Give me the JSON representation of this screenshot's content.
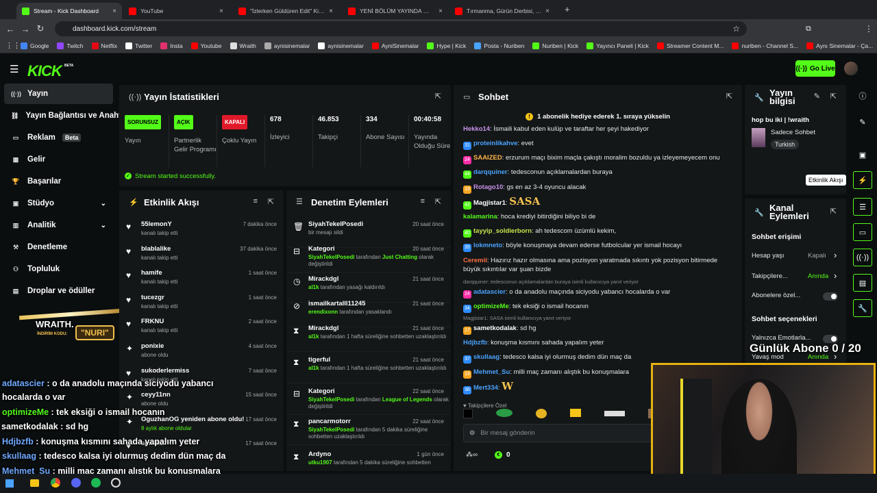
{
  "browser": {
    "tabs": [
      {
        "label": "Stream - Kick Dashboard",
        "active": true,
        "color": "#53fc18"
      },
      {
        "label": "YouTube",
        "active": false,
        "color": "#ff0000"
      },
      {
        "label": "\"İzlerken Güldüren Edit\" Kick &",
        "active": false,
        "color": "#ff0000"
      },
      {
        "label": "YENİ BÖLÜM YAYINDA 🏆 @O",
        "active": false,
        "color": "#ff0000"
      },
      {
        "label": "Tırmanma, Gürün Derbisi, Yüksel",
        "active": false,
        "color": "#ff0000"
      }
    ],
    "url": "dashboard.kick.com/stream",
    "bookmarks": [
      "Google",
      "Twitch",
      "Netflix",
      "Twitter",
      "Insta",
      "Youtube",
      "Wraith",
      "aynisinemalar",
      "aynisinemalar",
      "AyniSinemalar",
      "Hype | Kick",
      "Posta - Nuriben",
      "Nuriben | Kick",
      "Yayıncı Paneli | Kick",
      "Streamer Content M...",
      "nuriben - Channel S...",
      "Aynı Sinemalar - Ça..."
    ]
  },
  "header": {
    "logo": "KICK",
    "beta": "BETA",
    "go_live": "Go Live"
  },
  "sidebar": {
    "items": [
      {
        "label": "Yayın",
        "icon": "broadcast-icon",
        "glyph": "((·))"
      },
      {
        "label": "Yayın Bağlantısı ve Anahtarı",
        "icon": "link-icon",
        "glyph": "⛓"
      },
      {
        "label": "Reklam",
        "icon": "ad-icon",
        "glyph": "▭"
      },
      {
        "label": "Gelir",
        "icon": "revenue-icon",
        "glyph": "▦"
      },
      {
        "label": "Başarılar",
        "icon": "trophy-icon",
        "glyph": "🏆"
      },
      {
        "label": "Stüdyo",
        "icon": "studio-icon",
        "glyph": "▣"
      },
      {
        "label": "Analitik",
        "icon": "analytics-icon",
        "glyph": "▥"
      },
      {
        "label": "Denetleme",
        "icon": "moderation-icon",
        "glyph": "⚒"
      },
      {
        "label": "Topluluk",
        "icon": "community-icon",
        "glyph": "⚇"
      },
      {
        "label": "Droplar ve ödüller",
        "icon": "drops-icon",
        "glyph": "▤"
      }
    ],
    "beta_badge": "Beta"
  },
  "stats": {
    "title": "Yayın İstatistikleri",
    "cards": [
      {
        "badge": "SORUNSUZ",
        "badge_color": "#53fc18",
        "label": "Yayın"
      },
      {
        "badge": "AÇIK",
        "badge_color": "#53fc18",
        "label": "Partnerlik Gelir Programı"
      },
      {
        "badge": "KAPALI",
        "badge_color": "#e0192a",
        "label": "Çoklu Yayın"
      },
      {
        "value": "678",
        "label": "İzleyici"
      },
      {
        "value": "46.853",
        "label": "Takipçi"
      },
      {
        "value": "334",
        "label": "Abone Sayısı"
      },
      {
        "value": "00:40:58",
        "label": "Yayında Olduğu Süre"
      }
    ],
    "success": "Stream started successfully."
  },
  "activity": {
    "title": "Etkinlik Akışı",
    "items": [
      {
        "name": "55lemonY",
        "sub": "kanalı takip etti",
        "time": "7 dakika önce",
        "icon": "heart-icon",
        "glyph": "♥"
      },
      {
        "name": "blablalike",
        "sub": "kanalı takip etti",
        "time": "37 dakika önce",
        "icon": "heart-icon",
        "glyph": "♥"
      },
      {
        "name": "hamife",
        "sub": "kanalı takip etti",
        "time": "1 saat önce",
        "icon": "heart-icon",
        "glyph": "♥"
      },
      {
        "name": "tucezgr",
        "sub": "kanalı takip etti",
        "time": "1 saat önce",
        "icon": "heart-icon",
        "glyph": "♥"
      },
      {
        "name": "FRKNU",
        "sub": "kanalı takip etti",
        "time": "2 saat önce",
        "icon": "heart-icon",
        "glyph": "♥"
      },
      {
        "name": "ponixie",
        "sub": "abone oldu",
        "time": "4 saat önce",
        "icon": "sparkle-icon",
        "glyph": "✦"
      },
      {
        "name": "sukoderlermiss",
        "sub": "kanalı takip etti",
        "time": "7 saat önce",
        "icon": "heart-icon",
        "glyph": "♥"
      },
      {
        "name": "ceyy11nn",
        "sub": "abone oldu",
        "time": "15 saat önce",
        "icon": "sparkle-icon",
        "glyph": "✦"
      },
      {
        "name": "OguzhanOG yeniden abone oldu!",
        "sub": "8 aylık abone oldular",
        "time": "17 saat önce",
        "icon": "sparkle-icon",
        "glyph": "✦"
      },
      {
        "name": "sinelfl27",
        "sub": "",
        "time": "17 saat önce",
        "icon": "heart-icon",
        "glyph": "♥"
      }
    ]
  },
  "moderation": {
    "title": "Denetim Eylemleri",
    "items": [
      {
        "name": "SiyahTekelPosedi",
        "sub": "bir mesajı sildi",
        "time": "20 saat önce",
        "icon": "trash-icon",
        "glyph": "🗑"
      },
      {
        "name": "Kategori",
        "sub_g": "SiyahTekelPosedi",
        "sub": " tarafından ",
        "sub_g2": "Just Chatting",
        "sub2": " olarak değiştirildi",
        "time": "20 saat önce",
        "icon": "category-icon",
        "glyph": "⊟"
      },
      {
        "name": "Mirackdgl",
        "sub_g": "al1k",
        "sub": " tarafından yasağı kaldırıldı",
        "time": "21 saat önce",
        "icon": "clock-icon",
        "glyph": "◷"
      },
      {
        "name": "ismailkartalll11245",
        "sub_g": "erendixonn",
        "sub": " tarafından yasaklandı",
        "time": "21 saat önce",
        "icon": "ban-icon",
        "glyph": "⊘"
      },
      {
        "name": "Mirackdgl",
        "sub_g": "al1k",
        "sub": " tarafından 1 hafta süreliğine sohbetten uzaklaştırıldı",
        "time": "21 saat önce",
        "icon": "hourglass-icon",
        "glyph": "⧗"
      },
      {
        "name": "tigerful",
        "sub_g": "al1k",
        "sub": " tarafından 1 hafta süreliğine sohbetten uzaklaştırıldı",
        "time": "21 saat önce",
        "icon": "hourglass-icon",
        "glyph": "⧗"
      },
      {
        "name": "Kategori",
        "sub_g": "SiyahTekelPosedi",
        "sub": " tarafından ",
        "sub_g2": "League of Legends",
        "sub2": " olarak değiştirildi",
        "time": "22 saat önce",
        "icon": "category-icon",
        "glyph": "⊟"
      },
      {
        "name": "pancarmotorr",
        "sub_g": "SiyahTekelPosedi",
        "sub": " tarafından 5 dakika süreliğine sohbetten uzaklaştırıldı",
        "time": "22 saat önce",
        "icon": "hourglass-icon",
        "glyph": "⧗"
      },
      {
        "name": "Ardyno",
        "sub_g": "utku1907",
        "sub": " tarafından 5 dakika süreliğine sohbetten",
        "time": "1 gün önce",
        "icon": "hourglass-icon",
        "glyph": "⧗"
      }
    ]
  },
  "chat": {
    "title": "Sohbet",
    "pinned": "1 abonelik hediye ederek 1. sıraya yükselin",
    "messages": [
      {
        "user": "Hekko14",
        "color": "#c792ea",
        "text": "İsmaili kabul eden kulüp ve taraftar her şeyi hakediyor"
      },
      {
        "user": "proteinlikahve",
        "color": "#4aa3ff",
        "text": "evet",
        "badge": "31",
        "bcolor": "#2d8cff"
      },
      {
        "user": "SAAIZED",
        "color": "#ffb347",
        "text": "erzurum maçı bixim maçla çakıştı moralim bozuldu ya izleyemeyecem onu",
        "badge": "24",
        "bcolor": "#ff2da8"
      },
      {
        "user": "darqquiner",
        "color": "#4aa3ff",
        "text": "tedesconun açıklamalardan buraya",
        "badge": "44",
        "bcolor": "#53fc18"
      },
      {
        "user": "Rotago10",
        "color": "#c792ea",
        "text": "gs en az 3-4 oyuncu alacak",
        "badge": "19",
        "bcolor": "#f5a623"
      },
      {
        "user": "Magjistar1",
        "color": "#ffffff",
        "text": "SASA",
        "badge": "42",
        "bcolor": "#53fc18"
      },
      {
        "user": "kalamarina",
        "color": "#53fc18",
        "text": "hoca krediyi bitirdiğini biliyo bi de"
      },
      {
        "user": "tayyip_soldierborn",
        "color": "#c8e64c",
        "text": "ah tedescom üzümlü kekim,",
        "badge": "40",
        "bcolor": "#53fc18"
      },
      {
        "user": "lokmneto",
        "color": "#4aa3ff",
        "text": "böyle konuşmaya devam ederse futbolcular yer ismail hocayı",
        "badge": "35",
        "bcolor": "#2d8cff"
      },
      {
        "user": "Ceremii",
        "color": "#ff7043",
        "text": "Hazırız hazır olmasına ama pozisyon yaratmada sıkıntı yok pozisyon bitirmede büyük sıkıntılar var şuan bizde"
      },
      {
        "reply": "darqquiner: tedesconun açıklamalardan buraya isimli kullanıcıya yanıt veriyor"
      },
      {
        "user": "adatascier",
        "color": "#4aa3ff",
        "text": "o da anadolu maçında siciyodu yabancı hocalarda o var",
        "badge": "24",
        "bcolor": "#ff2da8"
      },
      {
        "user": "optimizeMe",
        "color": "#53fc18",
        "text": "tek eksiği o ismail hocanın",
        "badge": "34",
        "bcolor": "#2d8cff"
      },
      {
        "reply": "Magjistar1: SASA isimli kullanıcıya yanıt veriyor"
      },
      {
        "user": "sametkodalak",
        "color": "#ffffff",
        "text": "sd hg",
        "badge": "17",
        "bcolor": "#f5a623"
      },
      {
        "user": "Hdjbzfb",
        "color": "#4aa3ff",
        "text": "konuşma kısmını sahada yapalım yeter"
      },
      {
        "user": "skullaag",
        "color": "#4aa3ff",
        "text": "tedesco kalsa iyi olurmuş dedim dün maç da",
        "badge": "37",
        "bcolor": "#2d8cff"
      },
      {
        "user": "Mehmet_Su",
        "color": "#4aa3ff",
        "text": "milli maç zamanı alıştık bu konuşmalara",
        "badge": "19",
        "bcolor": "#f5a623"
      },
      {
        "user": "Mert334",
        "color": "#4aa3ff",
        "text": "W",
        "badge": "36",
        "bcolor": "#2d8cff"
      }
    ],
    "emote_label": "Takipçilere Özel",
    "input_placeholder": "Bir mesaj gönderin",
    "points": "0"
  },
  "stream_info": {
    "title": "Yayın bilgisi",
    "stream_title": "hop bu iki | !wraith",
    "category": "Sadece Sohbet",
    "tag": "Turkish"
  },
  "channel_actions": {
    "title": "Kanal Eylemleri",
    "chat_access": "Sohbet erişimi",
    "rows": [
      {
        "label": "Hesap yaşı",
        "value": "Kapalı",
        "value_color": "#a3a8ab",
        "kind": "chev"
      },
      {
        "label": "Takipçilere...",
        "value": "Anında",
        "value_color": "#53fc18",
        "kind": "chev"
      },
      {
        "label": "Abonelere özel...",
        "kind": "toggle"
      }
    ],
    "chat_options": "Sohbet seçenekleri",
    "rows2": [
      {
        "label": "Yalnızca Emotlarla...",
        "kind": "toggle"
      },
      {
        "label": "Yavaş mod",
        "value": "Anında",
        "value_color": "#53fc18",
        "kind": "chev"
      }
    ]
  },
  "right_rail": {
    "tooltip": "Etkinlik Akışı"
  },
  "overlay": {
    "promo_title": "WRAITH.",
    "promo_label": "İNDİRİM KODU:",
    "promo_code": "NURI",
    "goal": "Günlük Abone 0 / 20",
    "chat": [
      {
        "user": "adatascier",
        "color": "#6fa8ff",
        "text": " : o da anadolu maçında siciyodu yabancı"
      },
      {
        "user": "",
        "color": "#fff",
        "text": "hocalarda o var"
      },
      {
        "user": "optimizeMe",
        "color": "#53fc18",
        "text": " : tek eksiği o ismail hocanın"
      },
      {
        "user": "sametkodalak",
        "color": "#fff",
        "text": " : sd hg"
      },
      {
        "user": "Hdjbzfb",
        "color": "#6fa8ff",
        "text": " : konuşma kısmını sahada yapalım yeter"
      },
      {
        "user": "skullaag",
        "color": "#6fa8ff",
        "text": " : tedesco kalsa iyi olurmuş dedim dün maç da"
      },
      {
        "user": "Mehmet_Su",
        "color": "#6fa8ff",
        "text": " : milli maç zamanı alıştık bu konuşmalara"
      },
      {
        "user": "Mert334",
        "color": "#6fa8ff",
        "text": " : W"
      }
    ]
  }
}
